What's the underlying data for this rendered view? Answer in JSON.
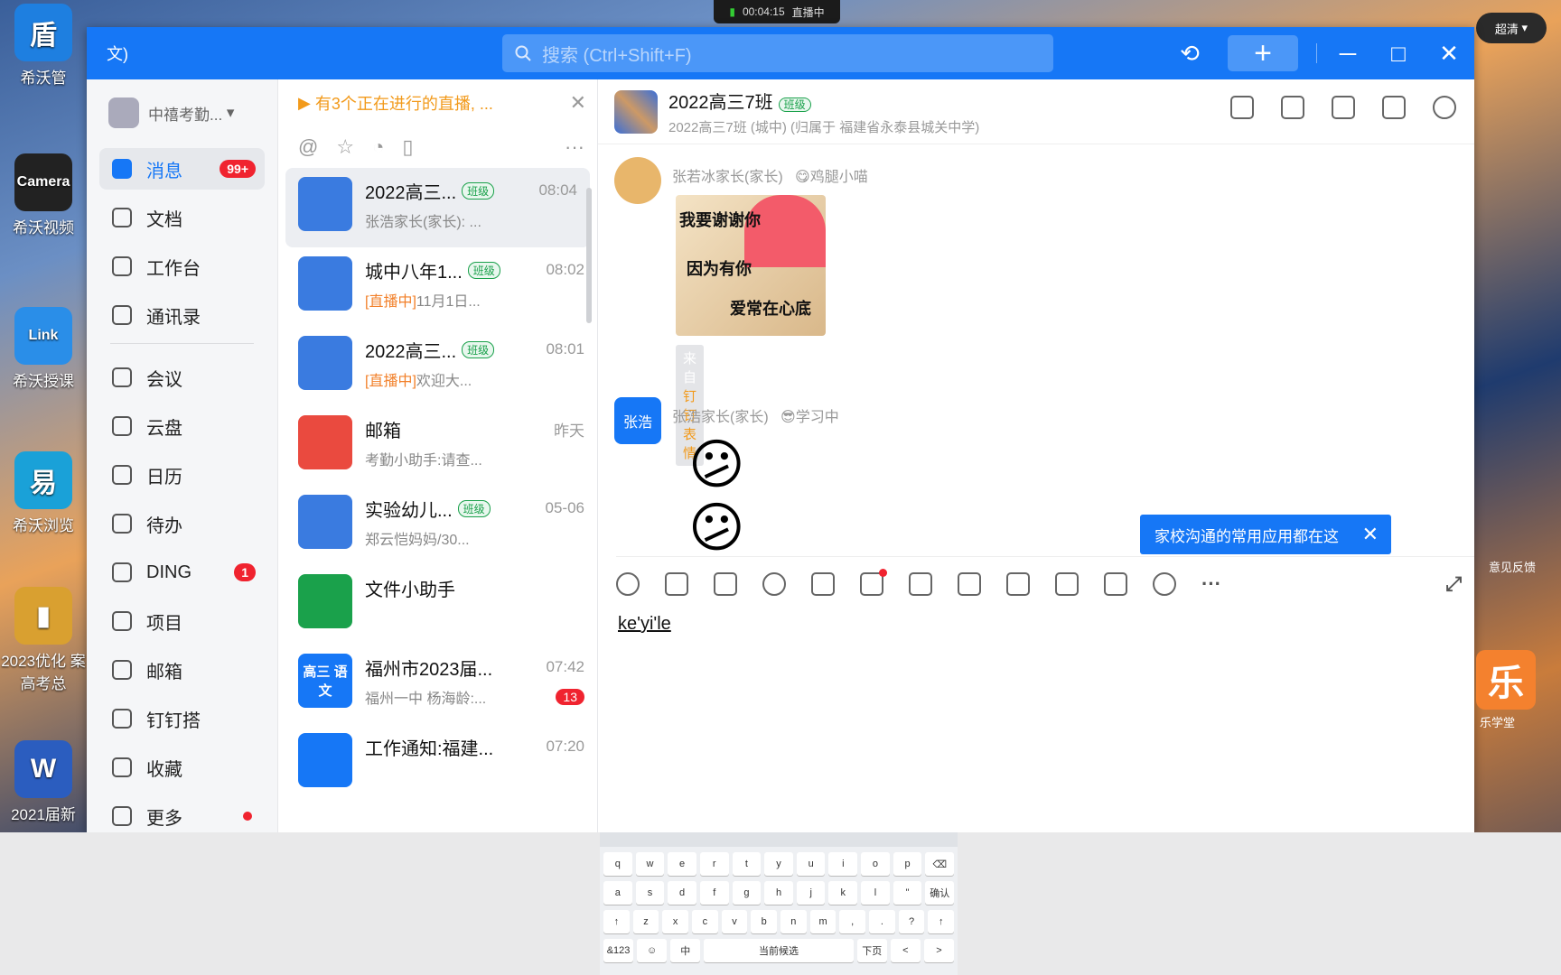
{
  "recorder": {
    "time": "00:04:15",
    "status": "直播中"
  },
  "quality": "超清",
  "desktop": {
    "icons": [
      {
        "label": "希沃管",
        "color": "#1e7fe0",
        "glyph": "盾"
      },
      {
        "label": "希沃视频",
        "color": "#222",
        "glyph": "Camera"
      },
      {
        "label": "希沃授课",
        "color": "#2a8ee8",
        "glyph": "Link"
      },
      {
        "label": "希沃浏览",
        "color": "#1aa1d8",
        "glyph": "易"
      },
      {
        "label": "2023优化 案高考总",
        "color": "#d9a030",
        "glyph": "▮"
      },
      {
        "label": "2021届新",
        "color": "#2b5dbf",
        "glyph": "W"
      }
    ]
  },
  "titlebar": {
    "lang": "文)",
    "search_placeholder": "搜索 (Ctrl+Shift+F)",
    "add": "+",
    "min": "─",
    "max": "□",
    "close": "✕",
    "history_icon": "history-icon"
  },
  "nav": {
    "org": "中禧考勤...",
    "items": [
      {
        "label": "消息",
        "badge": "99+",
        "active": true
      },
      {
        "label": "文档"
      },
      {
        "label": "工作台"
      },
      {
        "label": "通讯录"
      },
      {
        "label": "会议"
      },
      {
        "label": "云盘"
      },
      {
        "label": "日历"
      },
      {
        "label": "待办"
      },
      {
        "label": "DING",
        "badge": "1"
      },
      {
        "label": "项目"
      },
      {
        "label": "邮箱"
      },
      {
        "label": "钉钉搭"
      },
      {
        "label": "收藏"
      },
      {
        "label": "更多",
        "dot": true
      }
    ]
  },
  "list": {
    "live_note": "有3个正在进行的直播,  ...",
    "close": "✕",
    "more": "···",
    "conversations": [
      {
        "name": "2022高三...",
        "tag": "班级",
        "time": "08:04",
        "preview": "张浩家长(家长): ...",
        "selected": true
      },
      {
        "name": "城中八年1...",
        "tag": "班级",
        "time": "08:02",
        "live": "[直播中]",
        "preview": "11月1日..."
      },
      {
        "name": "2022高三...",
        "tag": "班级",
        "time": "08:01",
        "live": "[直播中]",
        "preview": "欢迎大..."
      },
      {
        "name": "邮箱",
        "time": "昨天",
        "preview": "考勤小助手:请查..."
      },
      {
        "name": "实验幼儿...",
        "tag": "班级",
        "time": "05-06",
        "preview": "郑云恺妈妈/30..."
      },
      {
        "name": "文件小助手",
        "time": "",
        "preview": ""
      },
      {
        "name": "福州市2023届...",
        "time": "07:42",
        "preview": "福州一中 杨海龄:...",
        "count": "13",
        "avatar_text": "高三 语文"
      },
      {
        "name": "工作通知:福建...",
        "time": "07:20",
        "preview": ""
      }
    ]
  },
  "chat": {
    "name": "2022高三7班",
    "tag": "班级",
    "subtitle": "2022高三7班 (城中) (归属于 福建省永泰县城关中学)",
    "messages": [
      {
        "sender": "张若冰家长(家长)",
        "status": "😋鸡腿小喵",
        "sticker_lines": [
          "我要谢谢你",
          "因为有你",
          "爱常在心底"
        ],
        "source_prefix": "来自",
        "source_name": "钉钉表情"
      },
      {
        "sender": "张浩家长(家长)",
        "status": "😎学习中",
        "avatar_text": "张浩",
        "emoji": "😕😕"
      }
    ],
    "tip": "家校沟通的常用应用都在这",
    "tip_close": "✕",
    "input_text": "ke'yi'le"
  },
  "keyboard": {
    "rows": [
      [
        "q",
        "w",
        "e",
        "r",
        "t",
        "y",
        "u",
        "i",
        "o",
        "p",
        "⌫"
      ],
      [
        "a",
        "s",
        "d",
        "f",
        "g",
        "h",
        "j",
        "k",
        "l",
        "\"",
        "确认"
      ],
      [
        "↑",
        "z",
        "x",
        "c",
        "v",
        "b",
        "n",
        "m",
        ",",
        ".",
        "?",
        "↑"
      ],
      [
        "&123",
        "☺",
        "中",
        "当前候选",
        "下页",
        "<",
        ">"
      ]
    ]
  },
  "side_app": {
    "glyph": "乐",
    "label": "乐学堂"
  },
  "feedback": "意见反馈"
}
